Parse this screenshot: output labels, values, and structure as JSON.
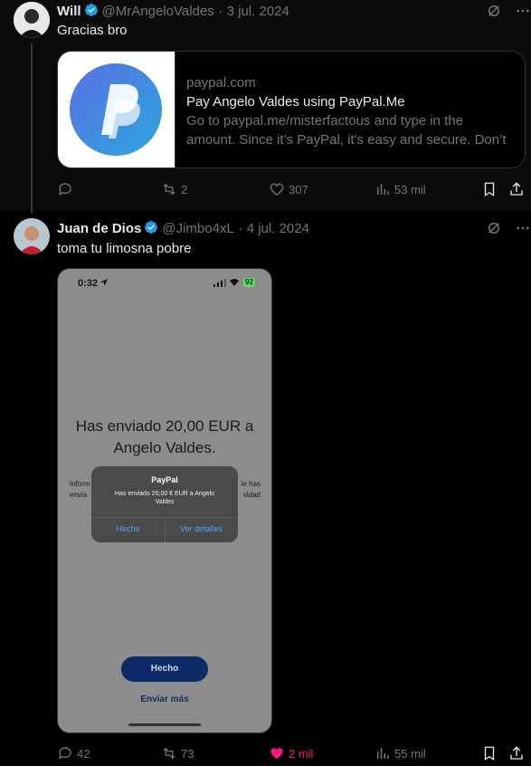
{
  "tweet1": {
    "name": "Will",
    "handle": "@MrAngeloValdes",
    "separator": "·",
    "date": "3 jul. 2024",
    "text": "Gracias bro",
    "card": {
      "domain": "paypal.com",
      "title": "Pay Angelo Valdes using PayPal.Me",
      "description": "Go to paypal.me/misterfactous and type in the amount. Since it’s PayPal, it's easy and secure. Don’t ..."
    },
    "actions": {
      "replies": "",
      "retweets": "2",
      "likes": "307",
      "views": "53 mil"
    }
  },
  "tweet2": {
    "name": "Juan de Dios",
    "handle": "@Jimbo4xL",
    "separator": "·",
    "date": "4 jul. 2024",
    "text": "toma tu limosna pobre",
    "screenshot": {
      "time": "0:32",
      "battery": "92",
      "sent_line1": "Has enviado 20,00 EUR a",
      "sent_line2": "Angelo Valdes.",
      "info_left": "Inform\nenvia",
      "info_right": "le has\nvidad",
      "alert_title": "PayPal",
      "alert_msg": "Has enviado 20,00 € EUR a Angelo Valdes",
      "alert_btn1": "Hecho",
      "alert_btn2": "Ver detalles",
      "done_btn": "Hecho",
      "send_more": "Enviar más"
    },
    "actions": {
      "replies": "42",
      "retweets": "73",
      "likes": "2 mil",
      "views": "55 mil"
    }
  },
  "colors": {
    "background": "#000000",
    "text": "#e7e9ea",
    "muted": "#71767b",
    "verified": "#1d9bf0",
    "like": "#f91880"
  }
}
